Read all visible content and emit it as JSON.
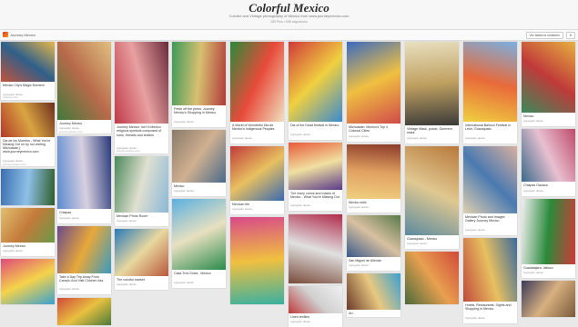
{
  "board": {
    "title": "Colorful Mexico",
    "subtitle": "Colorful and Vintage photography of Mexico from www.journeymexico.com",
    "stats": "285 Pins  •  558 seguidores"
  },
  "toolbar": {
    "owner": "Journey Mexico",
    "similar_label": "Ver tableros similares",
    "send_icon": "send-icon"
  },
  "columns": [
    [
      {
        "colors": [
          "#c4533a",
          "#2f5f8a",
          "#e8b84a"
        ],
        "desc": "Mexico City's Magic Moment",
        "meta": "Agregado desde",
        "source": "nytimes.com"
      },
      {
        "colors": [
          "#b33a2a",
          "#d9a441",
          "#6b2e1e"
        ],
        "desc": "Dia de los Muertos - What You're Missing Out on by not visiting Michoacán | www.journeymexico.com",
        "meta": "Agregado desde",
        "source": "journeymexico.com"
      },
      {
        "colors": [
          "#3b6fb0",
          "#8fc0e8",
          "#2e5d2a"
        ],
        "desc": "",
        "meta": "",
        "source": ""
      },
      {
        "colors": [
          "#e0c070",
          "#c47a3a",
          "#6a9a4a"
        ],
        "desc": "Journey Mexico",
        "meta": "Agregado desde",
        "source": ""
      },
      {
        "colors": [
          "#e04a7a",
          "#f5d34a",
          "#3aa0d0"
        ],
        "desc": "",
        "meta": "",
        "source": ""
      }
    ],
    [
      {
        "colors": [
          "#3f7a3a",
          "#b86a4a",
          "#e0c080"
        ],
        "desc": "Journey Mexico",
        "meta": "Agregado desde",
        "source": "journeymexico.com"
      },
      {
        "colors": [
          "#5a8ad0",
          "#d8d0e0",
          "#2a3a7a"
        ],
        "desc": "Chiapas",
        "meta": "Agregado desde",
        "source": ""
      },
      {
        "colors": [
          "#6a4a8a",
          "#e8a83a",
          "#3a9ac0"
        ],
        "desc": "Take a Day Trip Away From Cancún And Visit Chichen Itza",
        "meta": "Agregado desde",
        "source": ""
      },
      {
        "colors": [
          "#d04a3a",
          "#e8c040",
          "#4a7a3a"
        ],
        "desc": "",
        "meta": "",
        "source": ""
      }
    ],
    [
      {
        "colors": [
          "#c03a4a",
          "#e8a0a0",
          "#6a2a3a"
        ],
        "desc": "Journey Mexico: Isn't it Mexico religious symbols composed of lures, threads and textiles",
        "meta": "Agregado desde",
        "source": "journeymexico.com"
      },
      {
        "colors": [
          "#4a8a5a",
          "#e0e0d0",
          "#8ab8d8"
        ],
        "desc": "Mexican Photo Room",
        "meta": "Agregado desde",
        "source": ""
      },
      {
        "colors": [
          "#2a7ab8",
          "#e8d8a0",
          "#b8583a"
        ],
        "desc": "The colorful market",
        "meta": "Agregado desde",
        "source": ""
      }
    ],
    [
      {
        "colors": [
          "#3a9a5a",
          "#d8c070",
          "#b03a3a"
        ],
        "desc": "Fresh off the press: Journey Mexico's Shopping in Mexico",
        "meta": "Agregado desde",
        "source": ""
      },
      {
        "colors": [
          "#8a7a6a",
          "#d0b090",
          "#4a6a8a"
        ],
        "desc": "Mexico",
        "meta": "Agregado desde",
        "source": ""
      },
      {
        "colors": [
          "#5ab0e0",
          "#e8e0c0",
          "#2a8a4a"
        ],
        "desc": "Casa Tres Soles , Mexico",
        "meta": "Agregado desde",
        "source": ""
      }
    ],
    [
      {
        "colors": [
          "#2a8a3a",
          "#e84a3a",
          "#f0e0c0"
        ],
        "desc": "A World of Wonderful Dia de Mexico's Indigenous Peoples",
        "meta": "Agregado desde",
        "source": ""
      },
      {
        "colors": [
          "#c03a3a",
          "#e8c060",
          "#3a6ab0"
        ],
        "desc": "Mexican tile",
        "meta": "Agregado desde",
        "source": ""
      },
      {
        "colors": [
          "#d84a8a",
          "#f0c040",
          "#3ab0a0"
        ],
        "desc": "",
        "meta": "",
        "source": ""
      }
    ],
    [
      {
        "colors": [
          "#d03a3a",
          "#f0d040",
          "#3a8ad0"
        ],
        "desc": "Dia of the Dead festival in Mexico",
        "meta": "Agregado desde",
        "source": ""
      },
      {
        "colors": [
          "#e85a3a",
          "#f0e0a0",
          "#5a3a8a"
        ],
        "desc": "The many colors and masks of Mexico - What You're Missing Out",
        "meta": "Agregado desde",
        "source": ""
      },
      {
        "colors": [
          "#b02a4a",
          "#e0e0e0",
          "#7a4a3a"
        ],
        "desc": "",
        "meta": "",
        "source": ""
      },
      {
        "colors": [
          "#f0f0f0",
          "#d0d0d0",
          "#c03a3a"
        ],
        "desc": "Linen textiles",
        "meta": "Agregado desde",
        "source": ""
      }
    ],
    [
      {
        "colors": [
          "#3a6ac0",
          "#f0c040",
          "#d04a4a"
        ],
        "desc": "Michoacán: Mexico's Top 4 Colonial Cities",
        "meta": "Agregado desde",
        "source": ""
      },
      {
        "colors": [
          "#8a3a2a",
          "#e0a060",
          "#f0d080"
        ],
        "desc": "Mexico dolls",
        "meta": "Agregado desde",
        "source": ""
      },
      {
        "colors": [
          "#5a7a4a",
          "#d8c0a0",
          "#3a5a8a"
        ],
        "desc": "San Miguel de Allende",
        "meta": "Agregado desde",
        "source": ""
      },
      {
        "colors": [
          "#3aa0d0",
          "#e8c880",
          "#6a3a2a"
        ],
        "desc": "Art",
        "meta": "",
        "source": ""
      }
    ],
    [
      {
        "colors": [
          "#e8e0c0",
          "#c0a060",
          "#3a3a3a"
        ],
        "desc": "Vintage Mask, potosí, Guerrero mask",
        "meta": "Agregado desde",
        "source": ""
      },
      {
        "colors": [
          "#b8783a",
          "#e0c890",
          "#5a8aa0"
        ],
        "desc": "Guanajuato - Mexico",
        "meta": "Agregado desde",
        "source": ""
      },
      {
        "colors": [
          "#d04a3a",
          "#e8a050",
          "#4a6a3a"
        ],
        "desc": "",
        "meta": "",
        "source": ""
      }
    ],
    [
      {
        "colors": [
          "#7ab0e0",
          "#e86a3a",
          "#f0d040"
        ],
        "desc": "International Balloon Festival in León, Guanajuato",
        "meta": "Agregado desde",
        "source": ""
      },
      {
        "colors": [
          "#d8b0a0",
          "#4a7ab0",
          "#e0d0b0"
        ],
        "desc": "Mexican Photo and Images Gallery Journey Mexico",
        "meta": "Agregado desde",
        "source": ""
      },
      {
        "colors": [
          "#3a6a9a",
          "#e8c060",
          "#c04a3a"
        ],
        "desc": "Hotels, Restaurants, Sights and Shopping in Mexico",
        "meta": "Agregado desde",
        "source": ""
      }
    ],
    [
      {
        "colors": [
          "#e8b040",
          "#c03a3a",
          "#3a8a5a"
        ],
        "desc": "Mexico",
        "meta": "Agregado desde",
        "source": ""
      },
      {
        "colors": [
          "#c04a6a",
          "#e8c0d0",
          "#3a6a8a"
        ],
        "desc": "Chiapas Oaxaca",
        "meta": "Agregado desde",
        "source": ""
      },
      {
        "colors": [
          "#d03a3a",
          "#2a8a3a",
          "#f0f0f0"
        ],
        "desc": "Guadalajara, Jalisco",
        "meta": "Agregado desde",
        "source": ""
      },
      {
        "colors": [
          "#7a5a3a",
          "#d8b080",
          "#3a3a5a"
        ],
        "desc": "",
        "meta": "",
        "source": ""
      }
    ]
  ]
}
